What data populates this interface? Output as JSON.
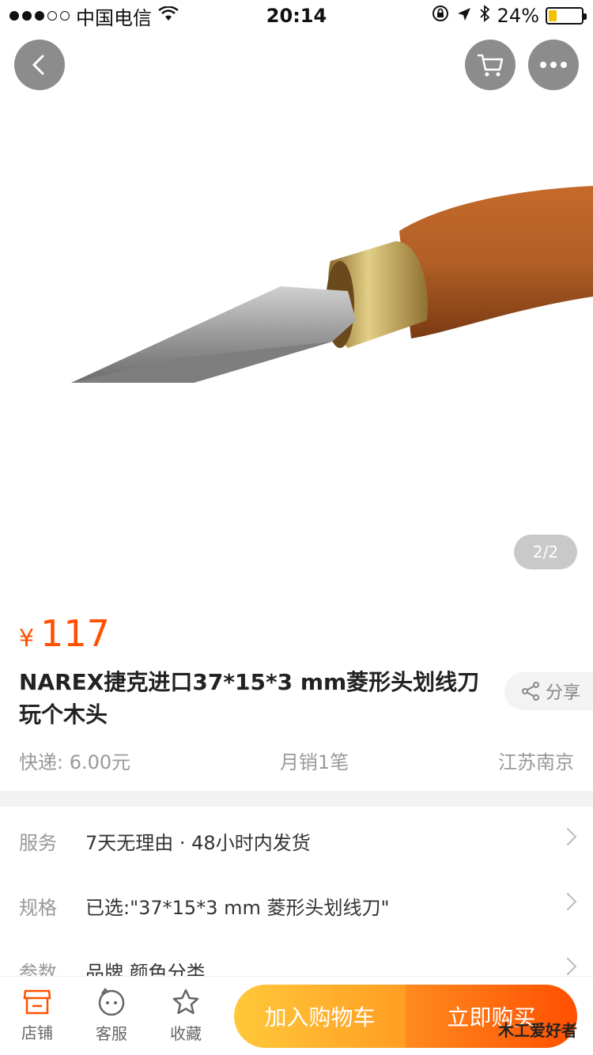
{
  "status_bar": {
    "carrier": "中国电信",
    "time": "20:14",
    "battery": "24%"
  },
  "hero": {
    "image_alt": "",
    "pager": "2/2"
  },
  "product": {
    "currency": "¥",
    "price": "117",
    "title": "NAREX捷克进口37*15*3 mm菱形头划线刀玩个木头",
    "share_label": "分享"
  },
  "meta": {
    "shipping": "快递: 6.00元",
    "monthly_sales": "月销1笔",
    "location": "江苏南京"
  },
  "rows": [
    {
      "label": "服务",
      "value": "7天无理由 · 48小时内发货"
    },
    {
      "label": "规格",
      "value": "已选:\"37*15*3 mm 菱形头划线刀\""
    },
    {
      "label": "参数",
      "value": "品牌 颜色分类"
    }
  ],
  "bottom": {
    "tabs": [
      {
        "label": "店铺",
        "icon": "store-icon"
      },
      {
        "label": "客服",
        "icon": "chat-icon"
      },
      {
        "label": "收藏",
        "icon": "star-icon"
      }
    ],
    "add_to_cart": "加入购物车",
    "buy_now": "立即购买"
  },
  "watermark": "木工爱好者",
  "colors": {
    "accent": "#ff5000",
    "cart": "#ffb22d",
    "buy": "#ff5a00"
  }
}
